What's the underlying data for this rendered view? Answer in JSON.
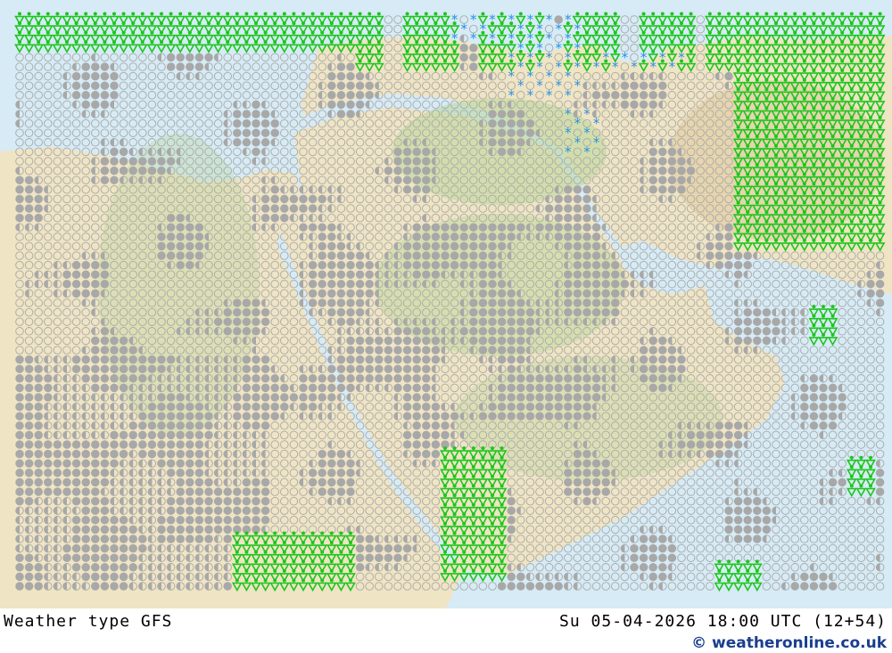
{
  "footer": {
    "product_label": "Weather type   GFS",
    "valid_time": "Su 05-04-2026 18:00 UTC (12+54)",
    "credit": "© weatheronline.co.uk"
  },
  "colors": {
    "sea": "#d6ebf5",
    "land": "#efe4c4",
    "land_green": "#b9d79a",
    "cloud_symbol": "#a8a8a8",
    "rain_symbol": "#1ec51e",
    "snow_symbol": "#2a8fe0"
  },
  "legend_symbols": {
    "clear": "open-circle",
    "partly_cloudy": "half-filled-circle",
    "overcast": "filled-circle",
    "rain_showers": "green-triangle",
    "snow": "blue-asterisk"
  }
}
